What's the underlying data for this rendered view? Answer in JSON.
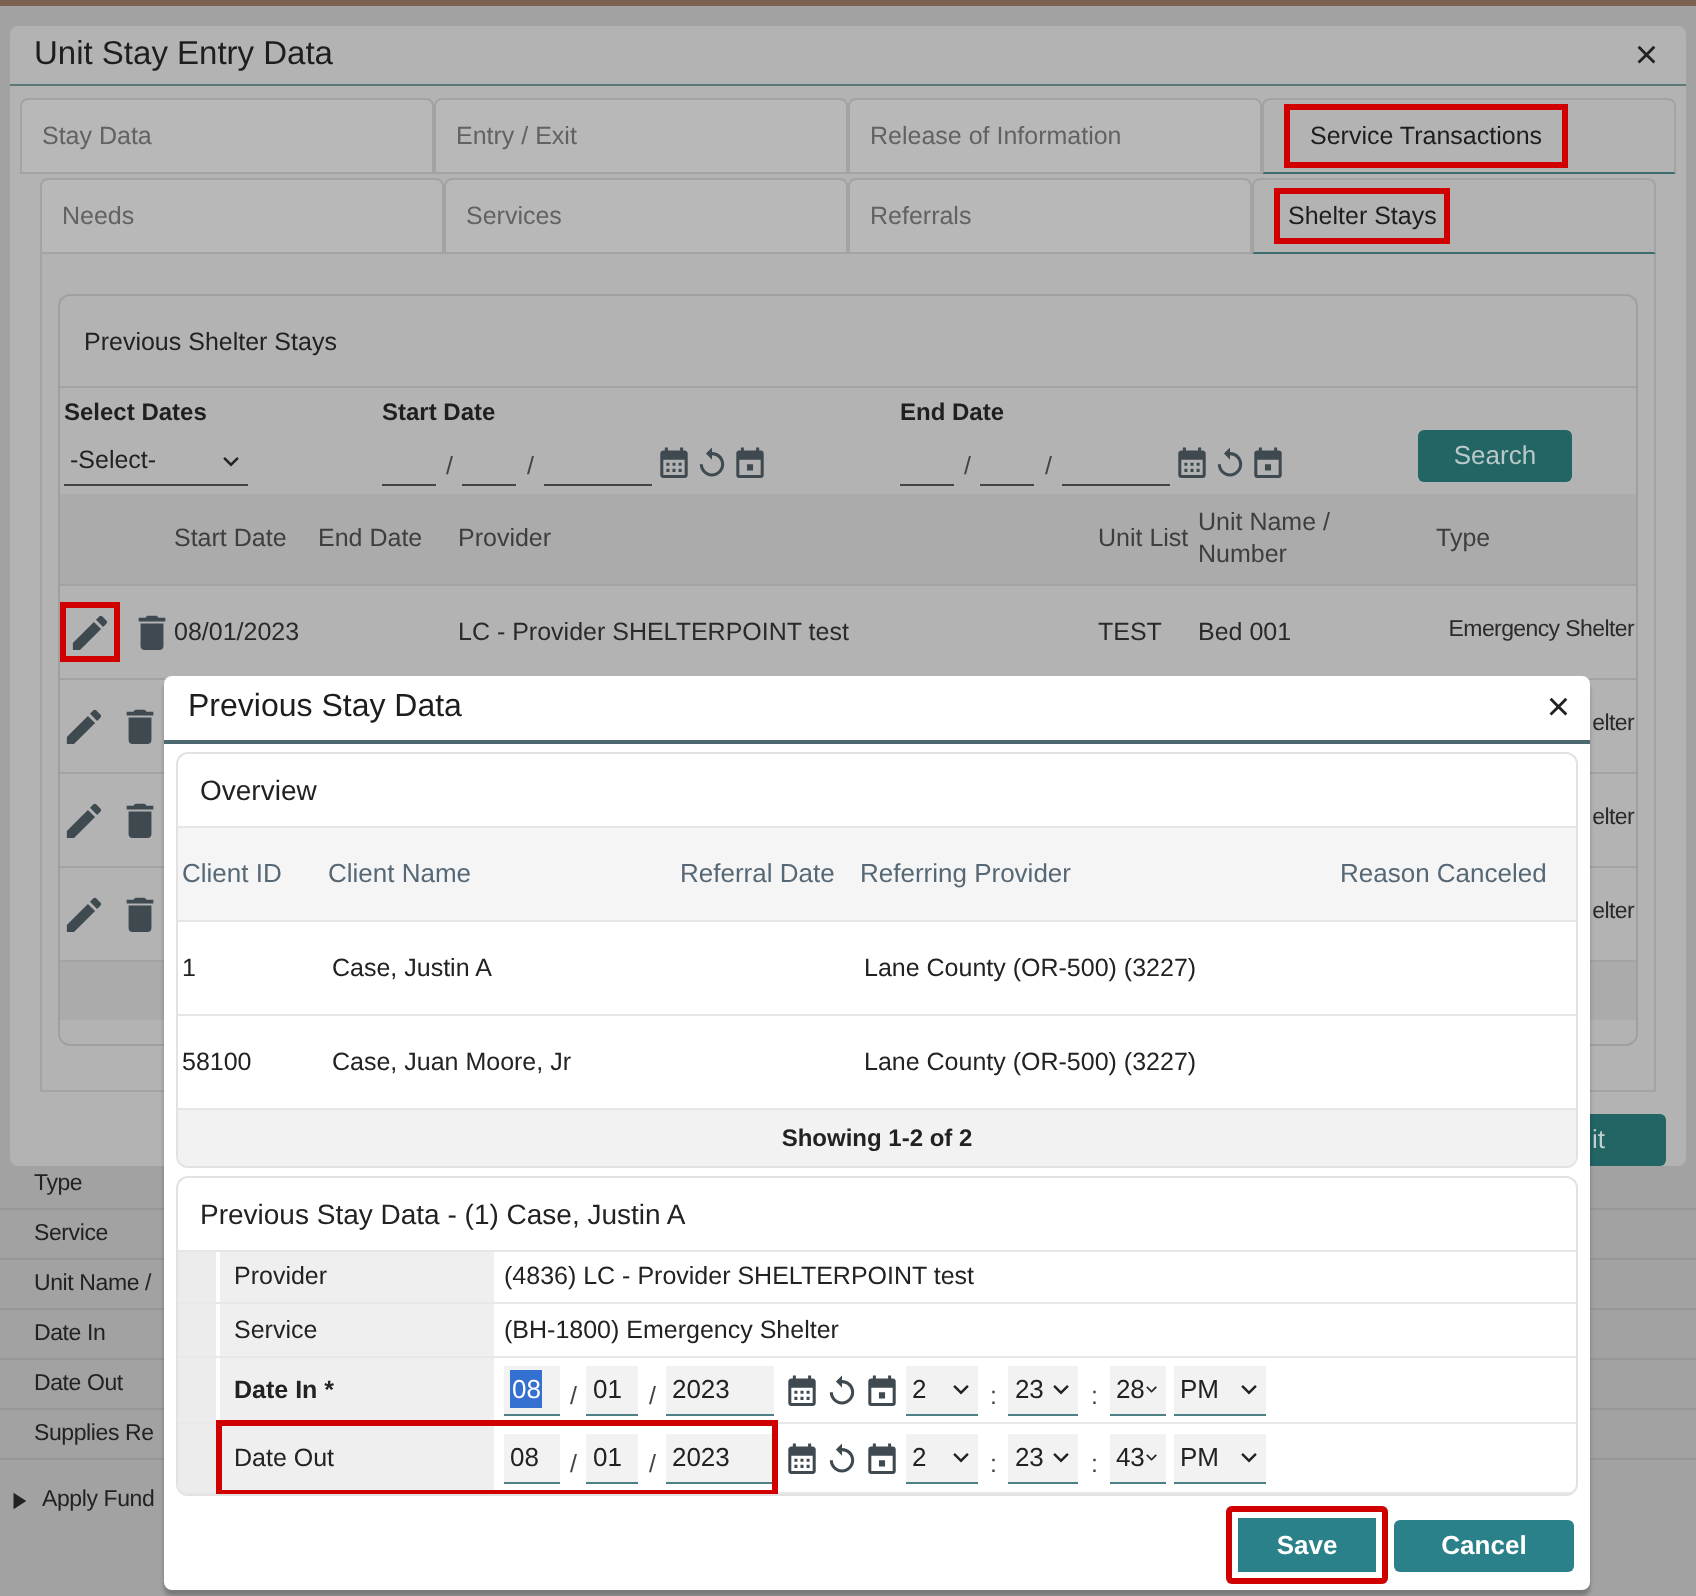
{
  "page_background": {
    "field_labels": [
      "Type",
      "Service",
      "Unit Name /",
      "Date In",
      "Date Out",
      "Supplies Re"
    ],
    "section": {
      "label": "Apply Fund",
      "expanded": false
    }
  },
  "window": {
    "title": "Unit Stay Entry Data",
    "close": "×",
    "tabs": [
      {
        "label": "Stay Data",
        "selected": false,
        "highlighted": false
      },
      {
        "label": "Entry / Exit",
        "selected": false,
        "highlighted": false
      },
      {
        "label": "Release of Information",
        "selected": false,
        "highlighted": false
      },
      {
        "label": "Service Transactions",
        "selected": true,
        "highlighted": true
      }
    ],
    "subtabs": [
      {
        "label": "Needs",
        "selected": false,
        "highlighted": false
      },
      {
        "label": "Services",
        "selected": false,
        "highlighted": false
      },
      {
        "label": "Referrals",
        "selected": false,
        "highlighted": false
      },
      {
        "label": "Shelter Stays",
        "selected": true,
        "highlighted": true
      }
    ],
    "panel": {
      "title": "Previous Shelter Stays",
      "filters": {
        "select_dates": {
          "label": "Select Dates",
          "value": "-Select-"
        },
        "start_date": {
          "label": "Start Date",
          "separators": [
            "/",
            "/"
          ]
        },
        "end_date": {
          "label": "End Date",
          "separators": [
            "/",
            "/"
          ]
        },
        "search_button": "Search"
      },
      "columns": [
        "Start Date",
        "End Date",
        "Provider",
        "Unit List",
        "Unit Name / Number",
        "Type"
      ],
      "rows": [
        {
          "start_date": "08/01/2023",
          "provider": "LC - Provider SHELTERPOINT test",
          "unit_list": "TEST",
          "unit_name": "Bed 001",
          "type": "Emergency Shelter",
          "highlighted": true
        },
        {
          "type": "elter",
          "highlighted": false
        },
        {
          "type": "elter",
          "highlighted": false
        },
        {
          "type": "elter",
          "highlighted": false
        }
      ]
    },
    "exit_button": "it"
  },
  "dialog": {
    "title": "Previous Stay Data",
    "close": "×",
    "overview": {
      "title": "Overview",
      "columns": [
        "Client ID",
        "Client Name",
        "Referral Date",
        "Referring Provider",
        "Reason Canceled"
      ],
      "rows": [
        {
          "client_id": "1",
          "client_name": "Case, Justin A",
          "referring_provider": "Lane County (OR-500) (3227)"
        },
        {
          "client_id": "58100",
          "client_name": "Case, Juan Moore, Jr",
          "referring_provider": "Lane County (OR-500) (3227)"
        }
      ],
      "footer": "Showing 1-2 of 2"
    },
    "detail": {
      "title": "Previous Stay Data - (1) Case, Justin A",
      "fields": [
        {
          "kind": "text",
          "label": "Provider",
          "value": "(4836) LC - Provider SHELTERPOINT test"
        },
        {
          "kind": "text",
          "label": "Service",
          "value": "(BH-1800) Emergency Shelter"
        },
        {
          "kind": "datetime",
          "label": "Date In",
          "required_mark": "*",
          "month": "08",
          "day": "01",
          "year": "2023",
          "hour": "2",
          "minute": "23",
          "second": "28",
          "ampm": "PM",
          "date_separators": [
            "/",
            "/"
          ],
          "time_separators": [
            ":",
            ":"
          ],
          "focused": true,
          "highlighted": false
        },
        {
          "kind": "datetime",
          "label": "Date Out",
          "month": "08",
          "day": "01",
          "year": "2023",
          "hour": "2",
          "minute": "23",
          "second": "43",
          "ampm": "PM",
          "date_separators": [
            "/",
            "/"
          ],
          "time_separators": [
            ":",
            ":"
          ],
          "focused": false,
          "highlighted": true
        }
      ]
    },
    "buttons": [
      {
        "label": "Save",
        "highlighted": true
      },
      {
        "label": "Cancel",
        "highlighted": false
      }
    ]
  }
}
